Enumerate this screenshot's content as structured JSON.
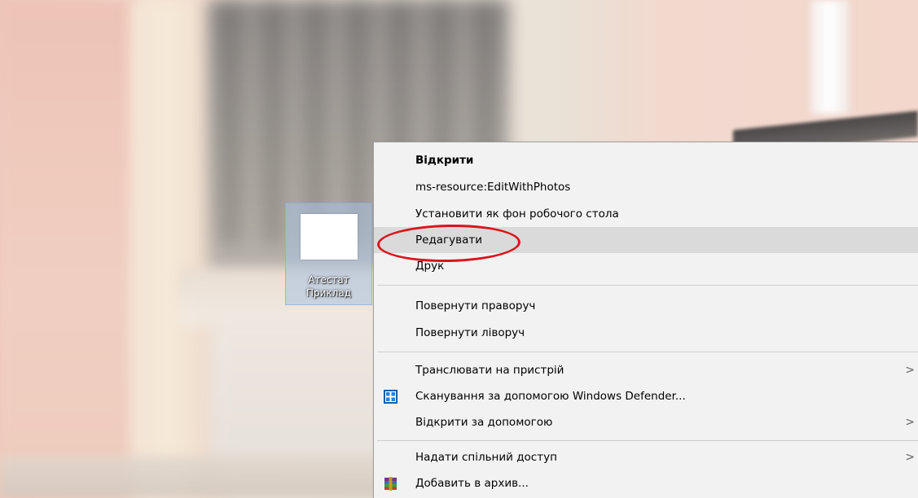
{
  "desktop": {
    "icon": {
      "label_line1": "Атестат",
      "label_line2": "Приклад",
      "selected": true
    }
  },
  "context_menu": {
    "items": [
      {
        "label": "Відкрити",
        "bold": true
      },
      {
        "label": "ms-resource:EditWithPhotos"
      },
      {
        "label": "Установити як фон робочого стола"
      },
      {
        "label": "Редагувати",
        "highlighted": true
      },
      {
        "label": "Друк"
      },
      {
        "label": "Повернути праворуч"
      },
      {
        "label": "Повернути ліворуч"
      },
      {
        "label": "Транслювати на пристрій",
        "submenu_arrow": ">"
      },
      {
        "label": "Сканування за допомогою Windows Defender...",
        "icon": "windows-defender-shield-icon"
      },
      {
        "label": "Відкрити за допомогою",
        "submenu_arrow": ">"
      },
      {
        "label": "Надати спільний доступ",
        "submenu_arrow": ">"
      },
      {
        "label": "Добавить в архив...",
        "icon": "winrar-archive-icon"
      }
    ]
  },
  "colors": {
    "menu_background": "#f2f2f2",
    "menu_hover": "#dadada",
    "annotation_red": "#d9141c",
    "defender_blue": "#1a6ab8",
    "icon_selection": "#aac3e1"
  }
}
